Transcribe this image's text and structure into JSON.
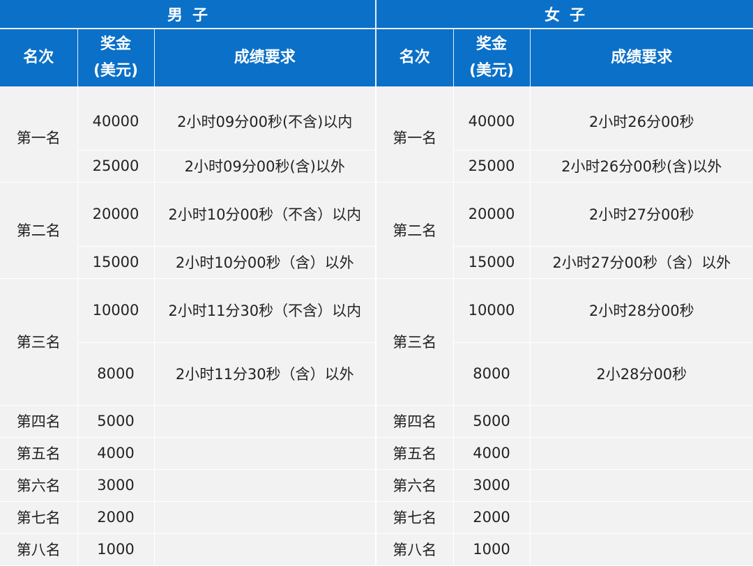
{
  "table": {
    "men_title": "男子",
    "women_title": "女子",
    "header": {
      "rank": "名次",
      "prize_line1": "奖金",
      "prize_line2": "(美元)",
      "requirement": "成绩要求"
    },
    "men": {
      "ranks": [
        "第一名",
        "第二名",
        "第三名",
        "第四名",
        "第五名",
        "第六名",
        "第七名",
        "第八名"
      ],
      "prizes": [
        "40000",
        "25000",
        "20000",
        "15000",
        "10000",
        "8000",
        "5000",
        "4000",
        "3000",
        "2000",
        "1000"
      ],
      "requirements": [
        "2小时09分00秒(不含)以内",
        "2小时09分00秒(含)以外",
        "2小时10分00秒（不含）以内",
        "2小时10分00秒（含）以外",
        "2小时11分30秒（不含）以内",
        "2小时11分30秒（含）以外"
      ]
    },
    "women": {
      "ranks": [
        "第一名",
        "第二名",
        "第三名",
        "第四名",
        "第五名",
        "第六名",
        "第七名",
        "第八名"
      ],
      "prizes": [
        "40000",
        "25000",
        "20000",
        "15000",
        "10000",
        "8000",
        "5000",
        "4000",
        "3000",
        "2000",
        "1000"
      ],
      "requirements": [
        "2小时26分00秒",
        "2小时26分00秒(含)以外",
        "2小时27分00秒",
        "2小时27分00秒（含）以外",
        "2小时28分00秒",
        "2小28分00秒"
      ]
    }
  }
}
